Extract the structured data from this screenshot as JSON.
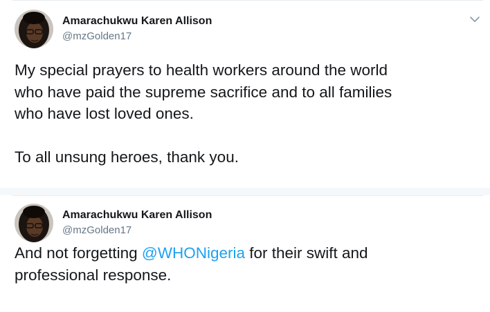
{
  "tweets": [
    {
      "author_name": "Amarachukwu Karen Allison",
      "handle": "@mzGolden17",
      "avatar": "profile-photo",
      "menu_icon": "chevron-down-icon",
      "text_lines": [
        "My special prayers to health workers around the world",
        "who have paid the supreme sacrifice and to all families",
        "who have lost loved ones."
      ],
      "text_line_2": "To all unsung heroes, thank you."
    },
    {
      "author_name": "Amarachukwu Karen Allison",
      "handle": "@mzGolden17",
      "avatar": "profile-photo",
      "text_before_mention": "And not forgetting ",
      "mention": "@WHONigeria",
      "text_after_mention": " for their swift and",
      "text_line_2": "professional response."
    }
  ],
  "colors": {
    "text": "#14171a",
    "secondary": "#657786",
    "link": "#1da1f2",
    "divider": "#e6ecf0"
  }
}
